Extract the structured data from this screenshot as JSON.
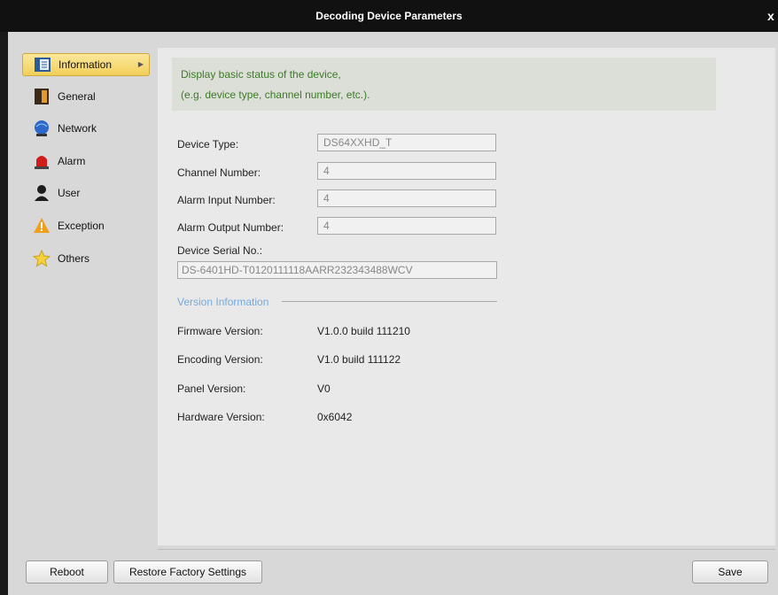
{
  "window": {
    "title": "Decoding Device Parameters",
    "close_glyph": "x"
  },
  "sidebar": {
    "items": [
      {
        "label": "Information",
        "icon": "information-icon",
        "active": true
      },
      {
        "label": "General",
        "icon": "general-icon"
      },
      {
        "label": "Network",
        "icon": "network-icon"
      },
      {
        "label": "Alarm",
        "icon": "alarm-icon"
      },
      {
        "label": "User",
        "icon": "user-icon"
      },
      {
        "label": "Exception",
        "icon": "exception-icon"
      },
      {
        "label": "Others",
        "icon": "others-icon"
      }
    ]
  },
  "info": {
    "line1": "Display basic status of the device,",
    "line2": "(e.g. device type, channel number, etc.)."
  },
  "fields": {
    "device_type": {
      "label": "Device Type:",
      "value": "DS64XXHD_T"
    },
    "channel_number": {
      "label": "Channel Number:",
      "value": "4"
    },
    "alarm_input": {
      "label": "Alarm Input Number:",
      "value": "4"
    },
    "alarm_output": {
      "label": "Alarm Output Number:",
      "value": "4"
    },
    "serial": {
      "label": "Device Serial No.:",
      "value": "DS-6401HD-T0120111118AARR232343488WCV"
    }
  },
  "version": {
    "header": "Version Information",
    "firmware": {
      "label": "Firmware Version:",
      "value": "V1.0.0 build 111210"
    },
    "encoding": {
      "label": "Encoding Version:",
      "value": "V1.0 build 111122"
    },
    "panel": {
      "label": "Panel Version:",
      "value": "V0"
    },
    "hardware": {
      "label": "Hardware Version:",
      "value": "0x6042"
    }
  },
  "buttons": {
    "reboot": "Reboot",
    "restore": "Restore Factory Settings",
    "save": "Save"
  },
  "colors": {
    "info_text": "#3c7a26",
    "version_header": "#79a9d8",
    "active_nav": "#f2cf5a"
  }
}
